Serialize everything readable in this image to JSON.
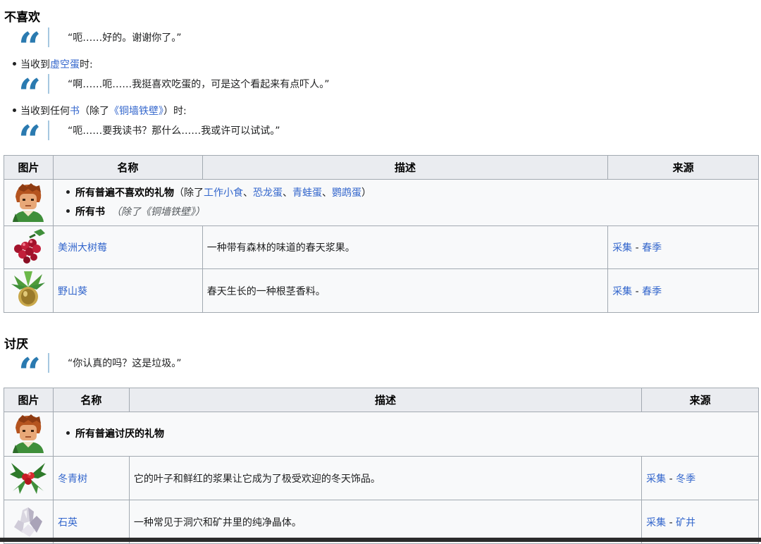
{
  "dislike": {
    "heading": "不喜欢",
    "quote1": "“呃……好的。谢谢你了。”",
    "cond1": {
      "pre": "当收到",
      "link": "虚空蛋",
      "post": "时:"
    },
    "quote2": "“啊……呃……我挺喜欢吃蛋的，可是这个看起来有点吓人。”",
    "cond2": {
      "pre": "当收到任何",
      "link": "书",
      "mid1": "（除了",
      "link2": "《铜墙铁壁》",
      "post": "）时:"
    },
    "quote3": "“呃……要我读书？那什么……我或许可以试试。”",
    "table": {
      "headers": [
        "图片",
        "名称",
        "描述",
        "来源"
      ],
      "universal": {
        "line1": {
          "pre": "所有",
          "link": "普遍不喜欢的礼物",
          "ex_pre": "（除了",
          "items": [
            "工作小食",
            "恐龙蛋",
            "青蛙蛋",
            "鹦鹉蛋"
          ],
          "sep": "、",
          "ex_post": "）"
        },
        "line2": {
          "pre": "所有",
          "link": "书",
          "ex_pre": "（除了",
          "item": "《铜墙铁壁》",
          "ex_post": "）"
        }
      },
      "rows": [
        {
          "name": "美洲大树莓",
          "desc": "一种带有森林的味道的春天浆果。",
          "src1": "采集",
          "sep": " - ",
          "src2": "春季",
          "icon": "salmonberry-icon"
        },
        {
          "name": "野山葵",
          "desc": "春天生长的一种根茎香料。",
          "src1": "采集",
          "sep": " - ",
          "src2": "春季",
          "icon": "wild-horseradish-icon"
        }
      ]
    }
  },
  "hate": {
    "heading": "讨厌",
    "quote": "“你认真的吗？这是垃圾。”",
    "table": {
      "headers": [
        "图片",
        "名称",
        "描述",
        "来源"
      ],
      "universal": {
        "pre": "所有",
        "link": "普遍讨厌的礼物"
      },
      "rows": [
        {
          "name": "冬青树",
          "desc": "它的叶子和鲜红的浆果让它成为了极受欢迎的冬天饰品。",
          "src1": "采集",
          "sep": " - ",
          "src2": "冬季",
          "icon": "holly-icon"
        },
        {
          "name": "石英",
          "desc": "一种常见于洞穴和矿井里的纯净晶体。",
          "src1": "采集",
          "sep": " - ",
          "src2": "矿井",
          "icon": "quartz-icon"
        }
      ]
    }
  },
  "icons": {
    "quote": "quote-mark-icon",
    "portrait": "alex-portrait-icon"
  },
  "colors": {
    "link": "#3366cc",
    "quote": "#2a7ab0",
    "header_bg": "#eaecf0",
    "cell_bg": "#f8f9fa",
    "border": "#a2a9b1"
  }
}
